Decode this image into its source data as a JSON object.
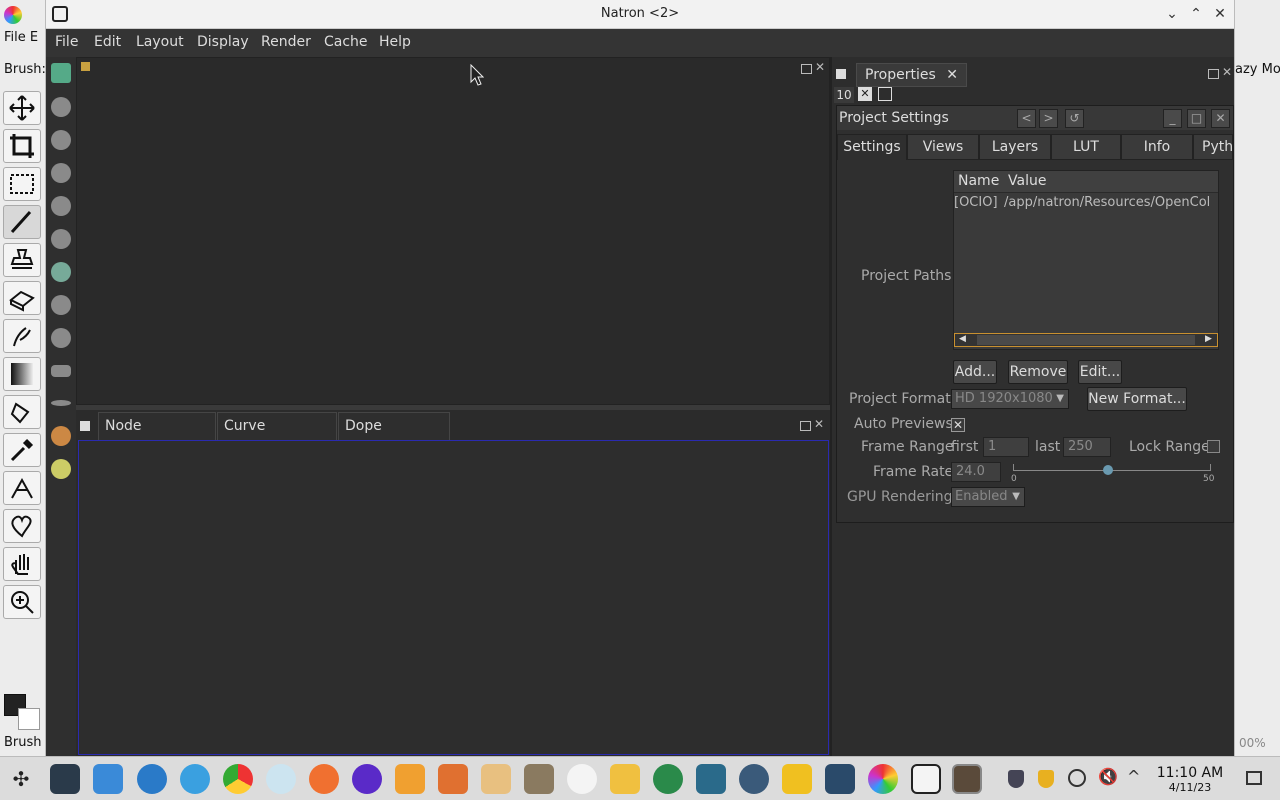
{
  "window": {
    "title": "Natron <2>"
  },
  "menu": [
    "File",
    "Edit",
    "Layout",
    "Display",
    "Render",
    "Cache",
    "Help"
  ],
  "background_app": {
    "menu_file": "File",
    "menu_e": "E",
    "brush_label": "Brush:",
    "status": "Brush",
    "right_text": "azy Mou",
    "right_zoom": "00%"
  },
  "panes": {
    "tabs": [
      {
        "label": "Node Graph",
        "close": "✕"
      },
      {
        "label": "Curve Editor",
        "close": "✕"
      },
      {
        "label": "Dope Sheet",
        "close": "✕"
      }
    ]
  },
  "properties": {
    "tab_label": "Properties",
    "tab_close": "✕",
    "count": "10",
    "panel_title": "Project Settings",
    "tabs": [
      "Settings",
      "Views",
      "Layers",
      "LUT",
      "Info",
      "Pyth"
    ],
    "project_paths": {
      "label": "Project Paths",
      "columns": [
        "Name",
        "Value"
      ],
      "rows": [
        {
          "name": "[OCIO]",
          "value": "/app/natron/Resources/OpenCol"
        }
      ],
      "buttons": [
        "Add...",
        "Remove",
        "Edit..."
      ]
    },
    "project_format": {
      "label": "Project Format",
      "value": "HD 1920x1080",
      "button": "New Format..."
    },
    "auto_previews": {
      "label": "Auto Previews",
      "checked": true
    },
    "frame_range": {
      "label": "Frame Range",
      "first_label": "first",
      "first": "1",
      "last_label": "last",
      "last": "250",
      "lock_label": "Lock Range"
    },
    "frame_rate": {
      "label": "Frame Rate",
      "value": "24.0",
      "slider_min": "0",
      "slider_max": "50",
      "slider_fraction": 0.48
    },
    "gpu_rendering": {
      "label": "GPU Rendering",
      "value": "Enabled"
    }
  },
  "clock": {
    "time": "11:10 AM",
    "date": "4/11/23"
  },
  "colors": {
    "accent_blue": "#2a2ab0",
    "slider_handle": "#6a9ab0"
  }
}
